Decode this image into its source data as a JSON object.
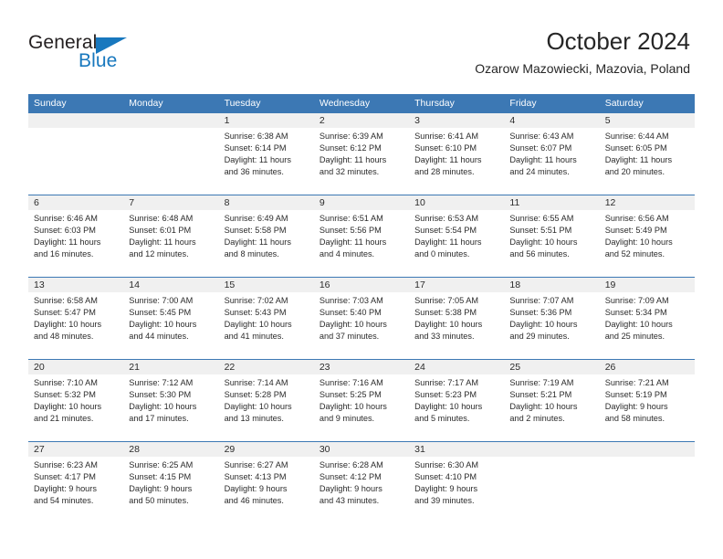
{
  "brand": {
    "name_part1": "General",
    "name_part2": "Blue",
    "logo_icon": "blue-triangle-icon",
    "accent_color": "#1878be"
  },
  "header": {
    "title": "October 2024",
    "subtitle": "Ozarow Mazowiecki, Mazovia, Poland"
  },
  "theme": {
    "header_blue": "#3c78b4",
    "daynum_band": "#f0f0f0",
    "text": "#2b2b2b"
  },
  "calendar": {
    "weekdays": [
      "Sunday",
      "Monday",
      "Tuesday",
      "Wednesday",
      "Thursday",
      "Friday",
      "Saturday"
    ],
    "weeks": [
      {
        "days": [
          {
            "num": "",
            "lines": []
          },
          {
            "num": "",
            "lines": []
          },
          {
            "num": "1",
            "lines": [
              "Sunrise: 6:38 AM",
              "Sunset: 6:14 PM",
              "Daylight: 11 hours",
              "and 36 minutes."
            ]
          },
          {
            "num": "2",
            "lines": [
              "Sunrise: 6:39 AM",
              "Sunset: 6:12 PM",
              "Daylight: 11 hours",
              "and 32 minutes."
            ]
          },
          {
            "num": "3",
            "lines": [
              "Sunrise: 6:41 AM",
              "Sunset: 6:10 PM",
              "Daylight: 11 hours",
              "and 28 minutes."
            ]
          },
          {
            "num": "4",
            "lines": [
              "Sunrise: 6:43 AM",
              "Sunset: 6:07 PM",
              "Daylight: 11 hours",
              "and 24 minutes."
            ]
          },
          {
            "num": "5",
            "lines": [
              "Sunrise: 6:44 AM",
              "Sunset: 6:05 PM",
              "Daylight: 11 hours",
              "and 20 minutes."
            ]
          }
        ]
      },
      {
        "days": [
          {
            "num": "6",
            "lines": [
              "Sunrise: 6:46 AM",
              "Sunset: 6:03 PM",
              "Daylight: 11 hours",
              "and 16 minutes."
            ]
          },
          {
            "num": "7",
            "lines": [
              "Sunrise: 6:48 AM",
              "Sunset: 6:01 PM",
              "Daylight: 11 hours",
              "and 12 minutes."
            ]
          },
          {
            "num": "8",
            "lines": [
              "Sunrise: 6:49 AM",
              "Sunset: 5:58 PM",
              "Daylight: 11 hours",
              "and 8 minutes."
            ]
          },
          {
            "num": "9",
            "lines": [
              "Sunrise: 6:51 AM",
              "Sunset: 5:56 PM",
              "Daylight: 11 hours",
              "and 4 minutes."
            ]
          },
          {
            "num": "10",
            "lines": [
              "Sunrise: 6:53 AM",
              "Sunset: 5:54 PM",
              "Daylight: 11 hours",
              "and 0 minutes."
            ]
          },
          {
            "num": "11",
            "lines": [
              "Sunrise: 6:55 AM",
              "Sunset: 5:51 PM",
              "Daylight: 10 hours",
              "and 56 minutes."
            ]
          },
          {
            "num": "12",
            "lines": [
              "Sunrise: 6:56 AM",
              "Sunset: 5:49 PM",
              "Daylight: 10 hours",
              "and 52 minutes."
            ]
          }
        ]
      },
      {
        "days": [
          {
            "num": "13",
            "lines": [
              "Sunrise: 6:58 AM",
              "Sunset: 5:47 PM",
              "Daylight: 10 hours",
              "and 48 minutes."
            ]
          },
          {
            "num": "14",
            "lines": [
              "Sunrise: 7:00 AM",
              "Sunset: 5:45 PM",
              "Daylight: 10 hours",
              "and 44 minutes."
            ]
          },
          {
            "num": "15",
            "lines": [
              "Sunrise: 7:02 AM",
              "Sunset: 5:43 PM",
              "Daylight: 10 hours",
              "and 41 minutes."
            ]
          },
          {
            "num": "16",
            "lines": [
              "Sunrise: 7:03 AM",
              "Sunset: 5:40 PM",
              "Daylight: 10 hours",
              "and 37 minutes."
            ]
          },
          {
            "num": "17",
            "lines": [
              "Sunrise: 7:05 AM",
              "Sunset: 5:38 PM",
              "Daylight: 10 hours",
              "and 33 minutes."
            ]
          },
          {
            "num": "18",
            "lines": [
              "Sunrise: 7:07 AM",
              "Sunset: 5:36 PM",
              "Daylight: 10 hours",
              "and 29 minutes."
            ]
          },
          {
            "num": "19",
            "lines": [
              "Sunrise: 7:09 AM",
              "Sunset: 5:34 PM",
              "Daylight: 10 hours",
              "and 25 minutes."
            ]
          }
        ]
      },
      {
        "days": [
          {
            "num": "20",
            "lines": [
              "Sunrise: 7:10 AM",
              "Sunset: 5:32 PM",
              "Daylight: 10 hours",
              "and 21 minutes."
            ]
          },
          {
            "num": "21",
            "lines": [
              "Sunrise: 7:12 AM",
              "Sunset: 5:30 PM",
              "Daylight: 10 hours",
              "and 17 minutes."
            ]
          },
          {
            "num": "22",
            "lines": [
              "Sunrise: 7:14 AM",
              "Sunset: 5:28 PM",
              "Daylight: 10 hours",
              "and 13 minutes."
            ]
          },
          {
            "num": "23",
            "lines": [
              "Sunrise: 7:16 AM",
              "Sunset: 5:25 PM",
              "Daylight: 10 hours",
              "and 9 minutes."
            ]
          },
          {
            "num": "24",
            "lines": [
              "Sunrise: 7:17 AM",
              "Sunset: 5:23 PM",
              "Daylight: 10 hours",
              "and 5 minutes."
            ]
          },
          {
            "num": "25",
            "lines": [
              "Sunrise: 7:19 AM",
              "Sunset: 5:21 PM",
              "Daylight: 10 hours",
              "and 2 minutes."
            ]
          },
          {
            "num": "26",
            "lines": [
              "Sunrise: 7:21 AM",
              "Sunset: 5:19 PM",
              "Daylight: 9 hours",
              "and 58 minutes."
            ]
          }
        ]
      },
      {
        "days": [
          {
            "num": "27",
            "lines": [
              "Sunrise: 6:23 AM",
              "Sunset: 4:17 PM",
              "Daylight: 9 hours",
              "and 54 minutes."
            ]
          },
          {
            "num": "28",
            "lines": [
              "Sunrise: 6:25 AM",
              "Sunset: 4:15 PM",
              "Daylight: 9 hours",
              "and 50 minutes."
            ]
          },
          {
            "num": "29",
            "lines": [
              "Sunrise: 6:27 AM",
              "Sunset: 4:13 PM",
              "Daylight: 9 hours",
              "and 46 minutes."
            ]
          },
          {
            "num": "30",
            "lines": [
              "Sunrise: 6:28 AM",
              "Sunset: 4:12 PM",
              "Daylight: 9 hours",
              "and 43 minutes."
            ]
          },
          {
            "num": "31",
            "lines": [
              "Sunrise: 6:30 AM",
              "Sunset: 4:10 PM",
              "Daylight: 9 hours",
              "and 39 minutes."
            ]
          },
          {
            "num": "",
            "lines": []
          },
          {
            "num": "",
            "lines": []
          }
        ]
      }
    ]
  }
}
